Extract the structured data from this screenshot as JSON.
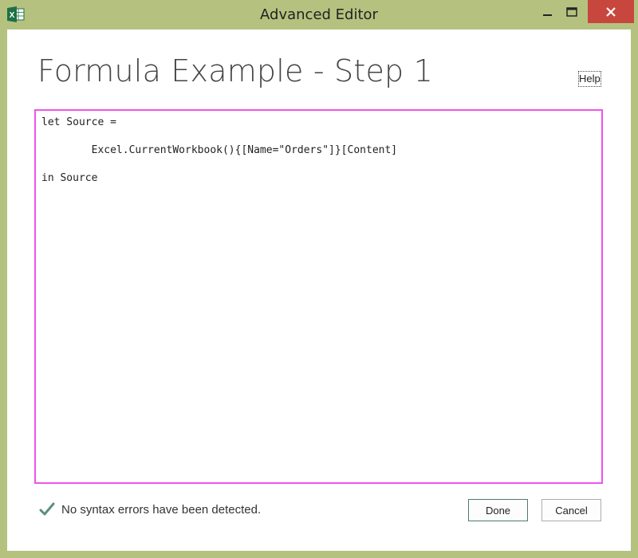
{
  "window": {
    "title": "Advanced Editor",
    "app_icon": "excel-icon",
    "controls": {
      "minimize_icon": "minimize-icon",
      "maximize_icon": "maximize-icon",
      "close_icon": "close-icon"
    },
    "frame_color": "#b5c27f",
    "close_color": "#c7473f"
  },
  "header": {
    "title": "Formula Example - Step 1",
    "help_label": "Help"
  },
  "editor": {
    "border_color": "#ee55e7",
    "lines": [
      "let Source =",
      "        Excel.CurrentWorkbook(){[Name=\"Orders\"]}[Content]",
      "in Source"
    ]
  },
  "status": {
    "icon": "check-icon",
    "text": "No syntax errors have been detected."
  },
  "buttons": {
    "done_label": "Done",
    "cancel_label": "Cancel"
  }
}
